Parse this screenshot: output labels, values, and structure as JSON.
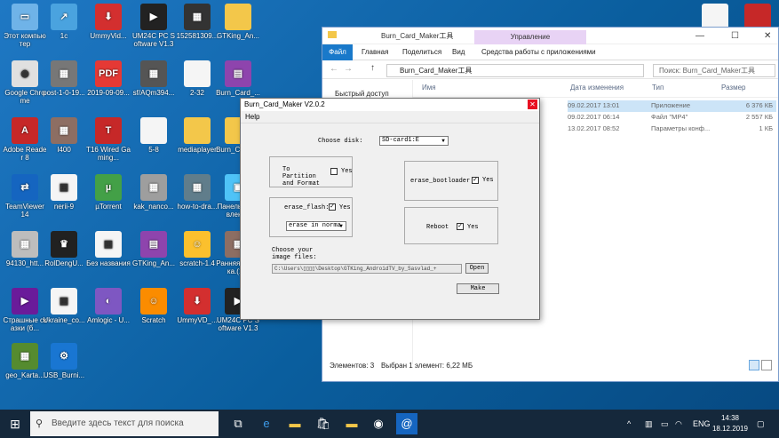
{
  "desktop": {
    "icons": [
      {
        "label": "Этот компьютер",
        "icon": "computer-icon",
        "color": "#6fb3e8",
        "glyph": "▭"
      },
      {
        "label": "1c",
        "icon": "shortcut-icon",
        "color": "#4aa3df",
        "glyph": "↗"
      },
      {
        "label": "UmmyVid...",
        "icon": "download-icon",
        "color": "#d32f2f",
        "glyph": "⬇"
      },
      {
        "label": "UM24C PC Software V1.3",
        "icon": "app-icon",
        "color": "#222",
        "glyph": "▶"
      },
      {
        "label": "152581309...",
        "icon": "photo-icon",
        "color": "#333",
        "glyph": "▦"
      },
      {
        "label": "GTKing_An...",
        "icon": "folder-icon",
        "color": "#f3c74a",
        "glyph": ""
      },
      {
        "label": "Google Chrome",
        "icon": "chrome-icon",
        "color": "#e0e0e0",
        "glyph": "◉"
      },
      {
        "label": "post-1-0-19...",
        "icon": "image-icon",
        "color": "#777",
        "glyph": "▦"
      },
      {
        "label": "2019-09-09...",
        "icon": "pdf-icon",
        "color": "#e53935",
        "glyph": "PDF"
      },
      {
        "label": "sf/AQm394...",
        "icon": "image-icon",
        "color": "#555",
        "glyph": "▦"
      },
      {
        "label": "2-32",
        "icon": "document-icon",
        "color": "#f5f5f5",
        "glyph": ""
      },
      {
        "label": "Burn_Card_...",
        "icon": "archive-icon",
        "color": "#8e44ad",
        "glyph": "▤"
      },
      {
        "label": "Adobe Reader 8",
        "icon": "adobe-icon",
        "color": "#c62828",
        "glyph": "A"
      },
      {
        "label": "I400",
        "icon": "image-icon",
        "color": "#8d6e63",
        "glyph": "▦"
      },
      {
        "label": "T16 Wired Gaming...",
        "icon": "gaming-icon",
        "color": "#c62828",
        "glyph": "T"
      },
      {
        "label": "5-8",
        "icon": "document-icon",
        "color": "#f5f5f5",
        "glyph": ""
      },
      {
        "label": "mediaplayer",
        "icon": "folder-icon",
        "color": "#f3c74a",
        "glyph": ""
      },
      {
        "label": "Burn_Card_...",
        "icon": "folder-icon",
        "color": "#f3c74a",
        "glyph": ""
      },
      {
        "label": "TeamViewer 14",
        "icon": "teamviewer-icon",
        "color": "#1565c0",
        "glyph": "⇄"
      },
      {
        "label": "nerii-9",
        "icon": "image-icon",
        "color": "#f5f5f5",
        "glyph": "▦"
      },
      {
        "label": "µTorrent",
        "icon": "utorrent-icon",
        "color": "#43a047",
        "glyph": "µ"
      },
      {
        "label": "kak_nanco...",
        "icon": "image-icon",
        "color": "#9e9e9e",
        "glyph": "▦"
      },
      {
        "label": "how-to-dra...",
        "icon": "image-icon",
        "color": "#607d8b",
        "glyph": "▦"
      },
      {
        "label": "Панель управления",
        "icon": "control-panel-icon",
        "color": "#4fc3f7",
        "glyph": "▣"
      },
      {
        "label": "94130_htt...",
        "icon": "image-icon",
        "color": "#bdbdbd",
        "glyph": "▦"
      },
      {
        "label": "RolDengU...",
        "icon": "app-icon",
        "color": "#212121",
        "glyph": "♛"
      },
      {
        "label": "Без названия",
        "icon": "image-icon",
        "color": "#f5f5f5",
        "glyph": "▦"
      },
      {
        "label": "GTKing_An...",
        "icon": "archive-icon",
        "color": "#8e44ad",
        "glyph": "▤"
      },
      {
        "label": "scratch-1.4",
        "icon": "scratch-icon",
        "color": "#fbc02d",
        "glyph": "☺"
      },
      {
        "label": "Ранняя Пташка.(1...",
        "icon": "image-icon",
        "color": "#8d6e63",
        "glyph": "▦"
      },
      {
        "label": "Страшные сказки (б...",
        "icon": "video-icon",
        "color": "#6a1b9a",
        "glyph": "▶"
      },
      {
        "label": "Ukraine_co...",
        "icon": "image-icon",
        "color": "#f5f5f5",
        "glyph": "▦"
      },
      {
        "label": "Amlogic - U...",
        "icon": "app-icon",
        "color": "#7e57c2",
        "glyph": "◐"
      },
      {
        "label": "Scratch",
        "icon": "scratch-icon",
        "color": "#fb8c00",
        "glyph": "☺"
      },
      {
        "label": "UmmyVD_...",
        "icon": "download-icon",
        "color": "#d32f2f",
        "glyph": "⬇"
      },
      {
        "label": "UM24C PC Software V1.3",
        "icon": "app-icon",
        "color": "#222",
        "glyph": "▶"
      },
      {
        "label": "geo_Karta...",
        "icon": "image-icon",
        "color": "#558b2f",
        "glyph": "▦"
      },
      {
        "label": "USB_Burni...",
        "icon": "usb-icon",
        "color": "#1976d2",
        "glyph": "⚙"
      }
    ],
    "right_icons": [
      {
        "label": "",
        "icon": "document-icon",
        "color": "#f5f5f5"
      },
      {
        "label": "",
        "icon": "app-icon",
        "color": "#c62828"
      },
      {
        "label": "Корзина",
        "icon": "recycle-bin-icon",
        "color": "#90caf9"
      }
    ]
  },
  "explorer": {
    "title": "Burn_Card_Maker工具",
    "ribbon_context": "Управление",
    "tabs": [
      "Файл",
      "Главная",
      "Поделиться",
      "Вид",
      "Средства работы с приложениями"
    ],
    "address": "Burn_Card_Maker工具",
    "search_placeholder": "Поиск: Burn_Card_Maker工具",
    "columns": [
      "Имя",
      "Дата изменения",
      "Тип",
      "Размер"
    ],
    "nav_item": "Быстрый доступ",
    "rows": [
      {
        "date": "09.02.2017 13:01",
        "type": "Приложение",
        "size": "6 376 КБ",
        "selected": true
      },
      {
        "date": "09.02.2017 06:14",
        "type": "Файл \"MP4\"",
        "size": "2 557 КБ",
        "selected": false
      },
      {
        "date": "13.02.2017 08:52",
        "type": "Параметры конф...",
        "size": "1 КБ",
        "selected": false
      }
    ],
    "status_count": "Элементов: 3",
    "status_selected": "Выбран 1 элемент: 6,22 МБ"
  },
  "dialog": {
    "title": "Burn_Card_Maker V2.0.2",
    "menu_help": "Help",
    "choose_disk_label": "Choose disk:",
    "disk_value": "SD-card1:E",
    "partition_label": "To Partition and Format",
    "yes": "Yes",
    "erase_bootloader_label": "erase_bootloader",
    "erase_flash_label": "erase_flash:",
    "erase_mode": "erase in norma",
    "reboot_label": "Reboot",
    "image_label": "Choose your image files:",
    "image_path": "C:\\Users\\▯▯▯▯\\Desktop\\GTKing_AndroidTV_by_Sasvlad_+",
    "open_button": "Open",
    "make_button": "Make",
    "partition_checked": false,
    "bootloader_checked": true,
    "erase_flash_checked": true,
    "reboot_checked": true
  },
  "taskbar": {
    "search_placeholder": "Введите здесь текст для поиска",
    "language": "ENG",
    "time": "14:38",
    "date": "18.12.2019"
  }
}
